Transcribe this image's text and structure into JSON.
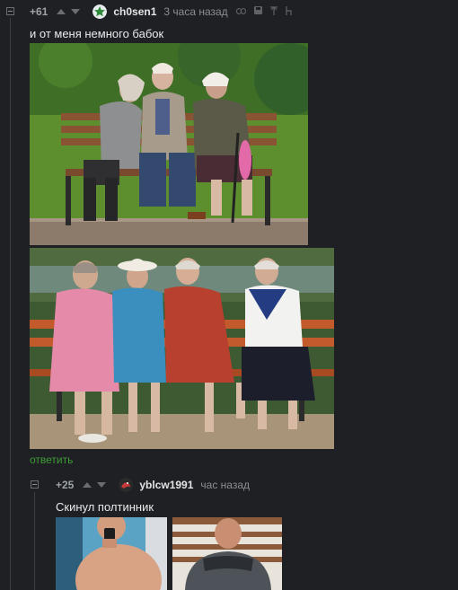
{
  "comments": [
    {
      "rating": "+61",
      "username": "ch0sen1",
      "time": "3 часа назад",
      "text": "и от меня немного бабок",
      "reply": "ответить",
      "avatar_icon": "green-star-avatar"
    },
    {
      "rating": "+25",
      "username": "yblcw1991",
      "time": "час назад",
      "text": "Скинул полтинник",
      "avatar_icon": "bird-avatar"
    }
  ],
  "colors": {
    "background": "#1e2023",
    "reply_link": "#3e9c38",
    "username": "#e2e4e6",
    "meta": "#8b8f93"
  }
}
